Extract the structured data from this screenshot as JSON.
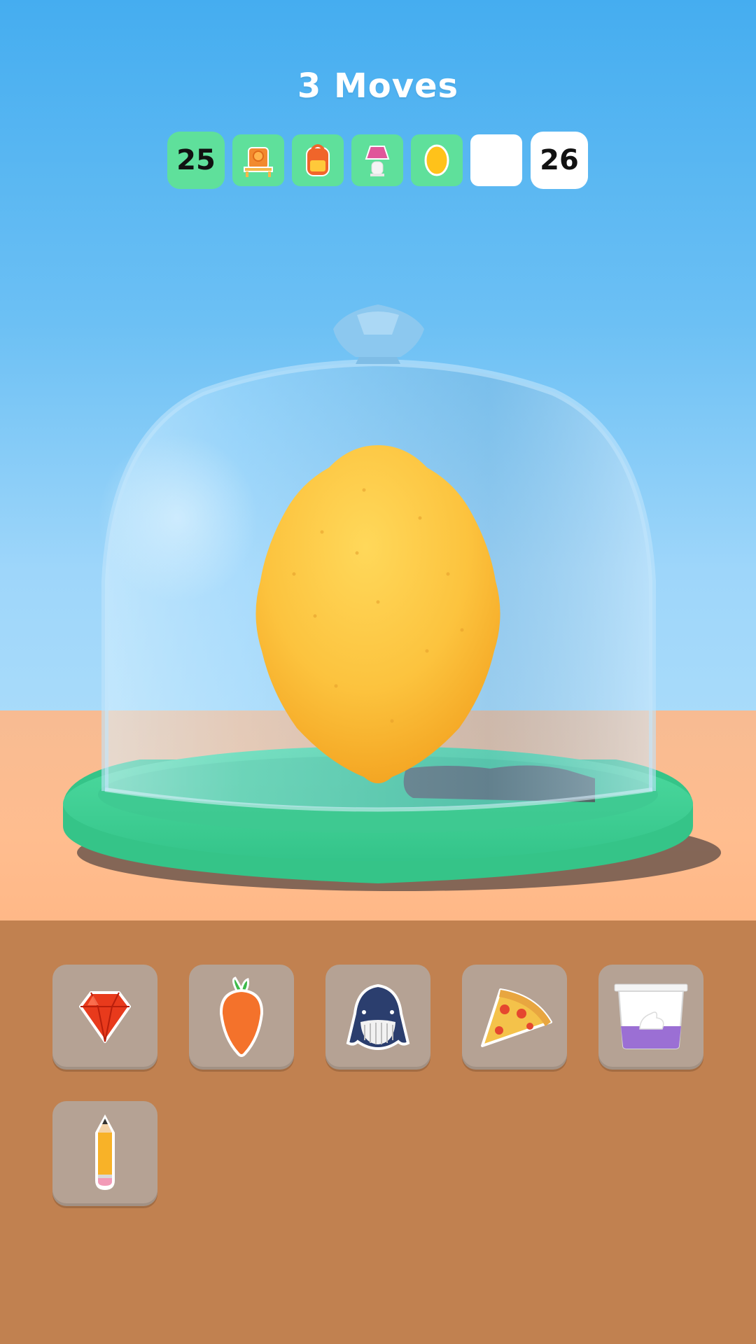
{
  "hud": {
    "moves_label": "3 Moves",
    "current_level": "25",
    "next_level": "26",
    "progress_items": [
      {
        "icon": "train-icon",
        "filled": true
      },
      {
        "icon": "backpack-icon",
        "filled": true
      },
      {
        "icon": "lamp-icon",
        "filled": true
      },
      {
        "icon": "lemon-icon",
        "filled": true
      },
      {
        "icon": "empty-slot",
        "filled": false
      }
    ],
    "colors": {
      "filled": "#5fe09b",
      "empty": "#ffffff"
    }
  },
  "scene": {
    "display_item": "lemon",
    "dome": "glass-cloche",
    "base_color": "#3fd08f"
  },
  "tray": {
    "items": [
      {
        "icon": "gem-icon"
      },
      {
        "icon": "carrot-icon"
      },
      {
        "icon": "whale-icon"
      },
      {
        "icon": "pizza-slice-icon"
      },
      {
        "icon": "yogurt-icon"
      },
      {
        "icon": "pencil-icon"
      }
    ]
  }
}
